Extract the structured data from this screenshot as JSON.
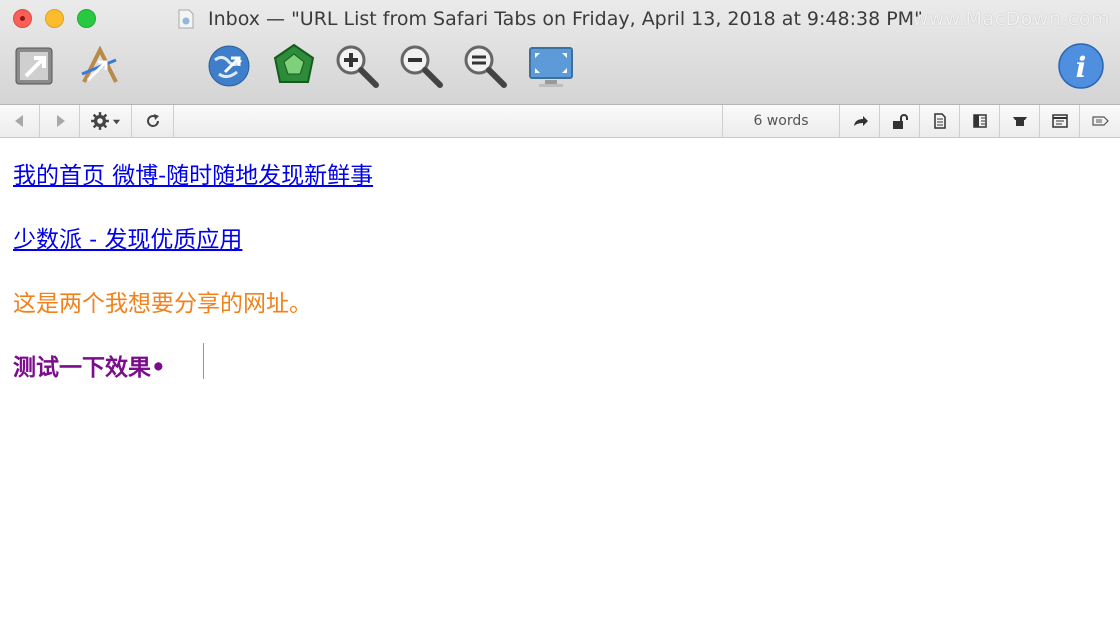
{
  "window": {
    "title": "Inbox — \"URL List from Safari Tabs on Friday, April 13, 2018 at 9:48:38 PM\"",
    "watermark": "www.MacDown.com"
  },
  "toolbar": {
    "icons": [
      "import-icon",
      "edit-source-icon",
      "browser-globe-icon",
      "green-gem-icon",
      "zoom-in-icon",
      "zoom-out-icon",
      "zoom-reset-icon",
      "monitor-icon",
      "info-icon"
    ]
  },
  "subbar": {
    "word_count": "6 words"
  },
  "document": {
    "link1": "我的首页 微博-随时随地发现新鲜事",
    "link2": "少数派 - 发现优质应用",
    "note": "这是两个我想要分享的网址。",
    "bold_line": "测试一下效果•"
  },
  "colors": {
    "link": "#0000ee",
    "note": "#f0821e",
    "bold_line": "#7b0c8c"
  }
}
